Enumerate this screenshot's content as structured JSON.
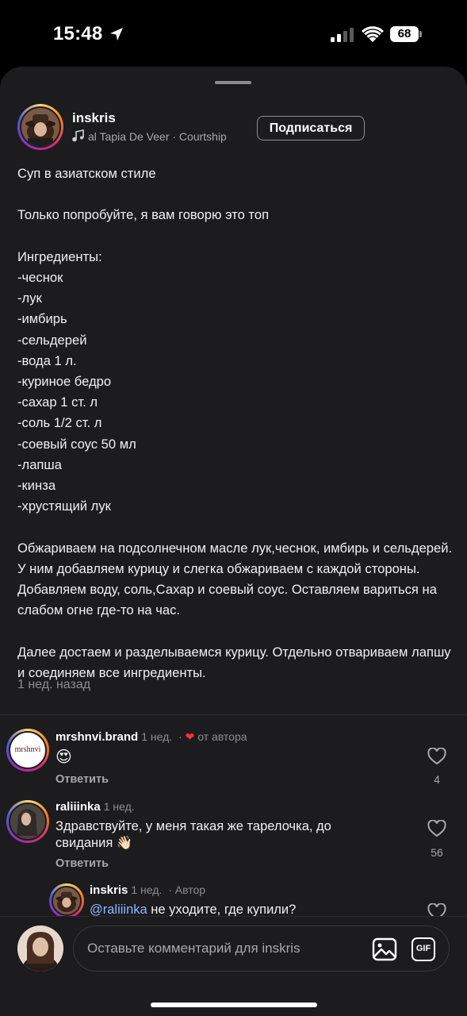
{
  "status_bar": {
    "time": "15:48",
    "battery": "68",
    "icons": [
      "location-arrow-icon",
      "cell-signal-icon",
      "wifi-icon",
      "battery-icon"
    ]
  },
  "post": {
    "username": "inskris",
    "music": "al Tapia De Veer · Courtship",
    "subscribe_label": "Подписаться",
    "caption": "Суп в азиатском стиле\n\nТолько попробуйте, я вам говорю это топ\n\nИнгредиенты:\n-чеснок\n-лук\n-имбирь\n-сельдерей\n-вода 1 л.\n-куриное бедро\n-сахар 1 ст. л\n-соль 1/2 ст. л\n-соевый соус 50 мл\n-лапша\n-кинза\n-хрустящий лук\n\nОбжариваем на подсолнечном масле лук,чеснок, имбирь и сельдерей. У ним добавляем курицу и слегка обжариваем с каждой стороны. Добавляем воду, соль,Сахар и соевый соус. Оставляем вариться на слабом огне где-то на час.\n\nДалее достаем и разделываемся курицу. Отдельно отвариваем лапшу и соединяем все ингредиенты.",
    "time_ago": "1 нед. назад"
  },
  "comments": [
    {
      "username": "mrshnvi.brand",
      "time": "1 нед.",
      "badge": "от автора",
      "text": "😍",
      "reply_label": "Ответить",
      "likes": "4",
      "avatar_text": "mrshnvi"
    },
    {
      "username": "raliiinka",
      "time": "1 нед.",
      "text": "Здравствуйте, у меня такая же тарелочка, до свидания 👋🏻",
      "reply_label": "Ответить",
      "likes": "56"
    },
    {
      "username": "inskris",
      "time": "1 нед.",
      "badge": "Автор",
      "mention": "@raliiinka",
      "text": " не уходите, где купили?"
    }
  ],
  "input": {
    "placeholder": "Оставьте комментарий для inskris",
    "gif_label": "GIF"
  },
  "colors": {
    "sheet_bg": "#1c1c1e",
    "mention": "#8fb5ff",
    "heart": "#ff3040"
  }
}
